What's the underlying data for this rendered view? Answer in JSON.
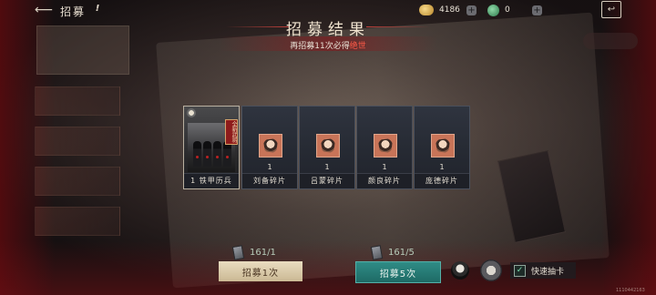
{
  "topbar": {
    "title": "招募",
    "gold_amount": "4186",
    "jade_amount": "0"
  },
  "header": {
    "title": "招募结果",
    "subtitle_prefix": "再招募11次必得",
    "subtitle_highlight": "绝世"
  },
  "cards": [
    {
      "type": "hero",
      "label": "1 铁甲历兵",
      "badge": "全新武将"
    },
    {
      "type": "fragment",
      "count": "1",
      "label": "刘备碎片"
    },
    {
      "type": "fragment",
      "count": "1",
      "label": "吕蒙碎片"
    },
    {
      "type": "fragment",
      "count": "1",
      "label": "颜良碎片"
    },
    {
      "type": "fragment",
      "count": "1",
      "label": "庞德碎片"
    }
  ],
  "bottom": {
    "cost_once": "161/1",
    "cost_five": "161/5",
    "btn_once": "招募1次",
    "btn_five": "招募5次",
    "quick_label": "快速抽卡",
    "quick_checked": true,
    "build_id": "1110442163"
  },
  "colors": {
    "accent_red": "#ff5a47",
    "teal_button": "#2f8c86",
    "cream_button": "#e9dcc0"
  },
  "icons": {
    "back": "back-arrow-icon",
    "info": "info-icon",
    "gold": "gold-ingot-icon",
    "jade": "jade-coin-icon",
    "exit": "exit-icon",
    "token": "recruit-token-icon"
  }
}
